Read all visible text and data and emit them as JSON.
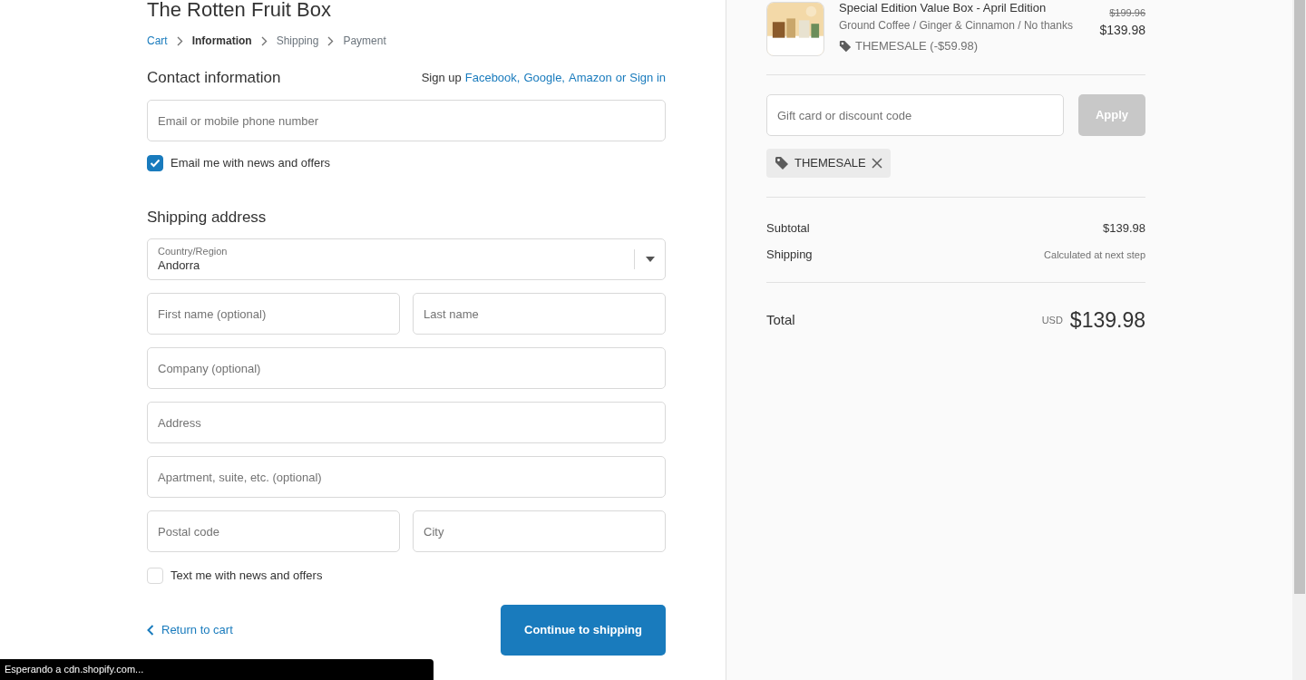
{
  "store_title": "The Rotten Fruit Box",
  "breadcrumbs": [
    {
      "label": "Cart",
      "kind": "link"
    },
    {
      "label": "Information",
      "kind": "current"
    },
    {
      "label": "Shipping",
      "kind": "plain"
    },
    {
      "label": "Payment",
      "kind": "plain"
    }
  ],
  "contact": {
    "heading": "Contact information",
    "signup_prefix": "Sign up",
    "signup_links": [
      "Facebook,",
      "Google,",
      "Amazon"
    ],
    "signup_or": "or",
    "signin_link": "Sign in",
    "email_placeholder": "Email or mobile phone number",
    "newsletter": {
      "label": "Email me with news and offers",
      "checked": true
    }
  },
  "shipping": {
    "heading": "Shipping address",
    "country_label": "Country/Region",
    "country_value": "Andorra",
    "fields": [
      {
        "placeholder": "First name (optional)",
        "half": true
      },
      {
        "placeholder": "Last name",
        "half": true
      },
      {
        "placeholder": "Company (optional)",
        "half": false
      },
      {
        "placeholder": "Address",
        "half": false
      },
      {
        "placeholder": "Apartment, suite, etc. (optional)",
        "half": false
      },
      {
        "placeholder": "Postal code",
        "half": true
      },
      {
        "placeholder": "City",
        "half": true
      }
    ],
    "sms": {
      "label": "Text me with news and offers",
      "checked": false
    }
  },
  "return_link": "Return to cart",
  "continue_button": "Continue to shipping",
  "summary": {
    "product": {
      "title": "Special Edition Value Box - April Edition",
      "variant": "Ground Coffee / Ginger & Cinnamon / No thanks",
      "discount": "THEMESALE (-$59.98)",
      "original_price": "$199.96",
      "price": "$139.98"
    },
    "discount_placeholder": "Gift card or discount code",
    "apply_button": "Apply",
    "apply_disabled": true,
    "applied_code": "THEMESALE",
    "lines": [
      {
        "label": "Subtotal",
        "value": "$139.98",
        "kind": "amount"
      },
      {
        "label": "Shipping",
        "value": "Calculated at next step",
        "kind": "note"
      }
    ],
    "total_label": "Total",
    "currency": "USD",
    "total": "$139.98"
  },
  "status_bar": "Esperando a cdn.shopify.com..."
}
